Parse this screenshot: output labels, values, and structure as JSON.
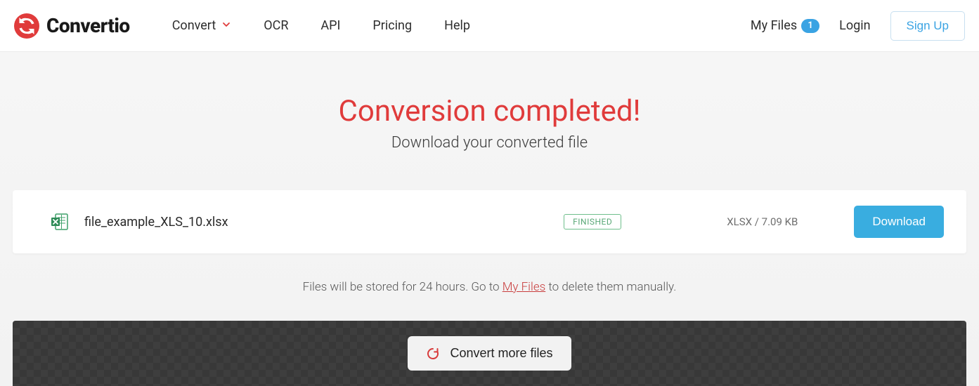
{
  "header": {
    "logo_text": "Convertio",
    "nav": {
      "convert": "Convert",
      "ocr": "OCR",
      "api": "API",
      "pricing": "Pricing",
      "help": "Help"
    },
    "right": {
      "my_files": "My Files",
      "my_files_count": "1",
      "login": "Login",
      "signup": "Sign Up"
    }
  },
  "main": {
    "title": "Conversion completed!",
    "subtitle": "Download your converted file"
  },
  "file": {
    "name": "file_example_XLS_10.xlsx",
    "status": "FINISHED",
    "meta": "XLSX / 7.09 KB",
    "download_label": "Download"
  },
  "notice": {
    "prefix": "Files will be stored for 24 hours. Go to ",
    "link": "My Files",
    "suffix": " to delete them manually."
  },
  "footer": {
    "convert_more": "Convert more files"
  }
}
